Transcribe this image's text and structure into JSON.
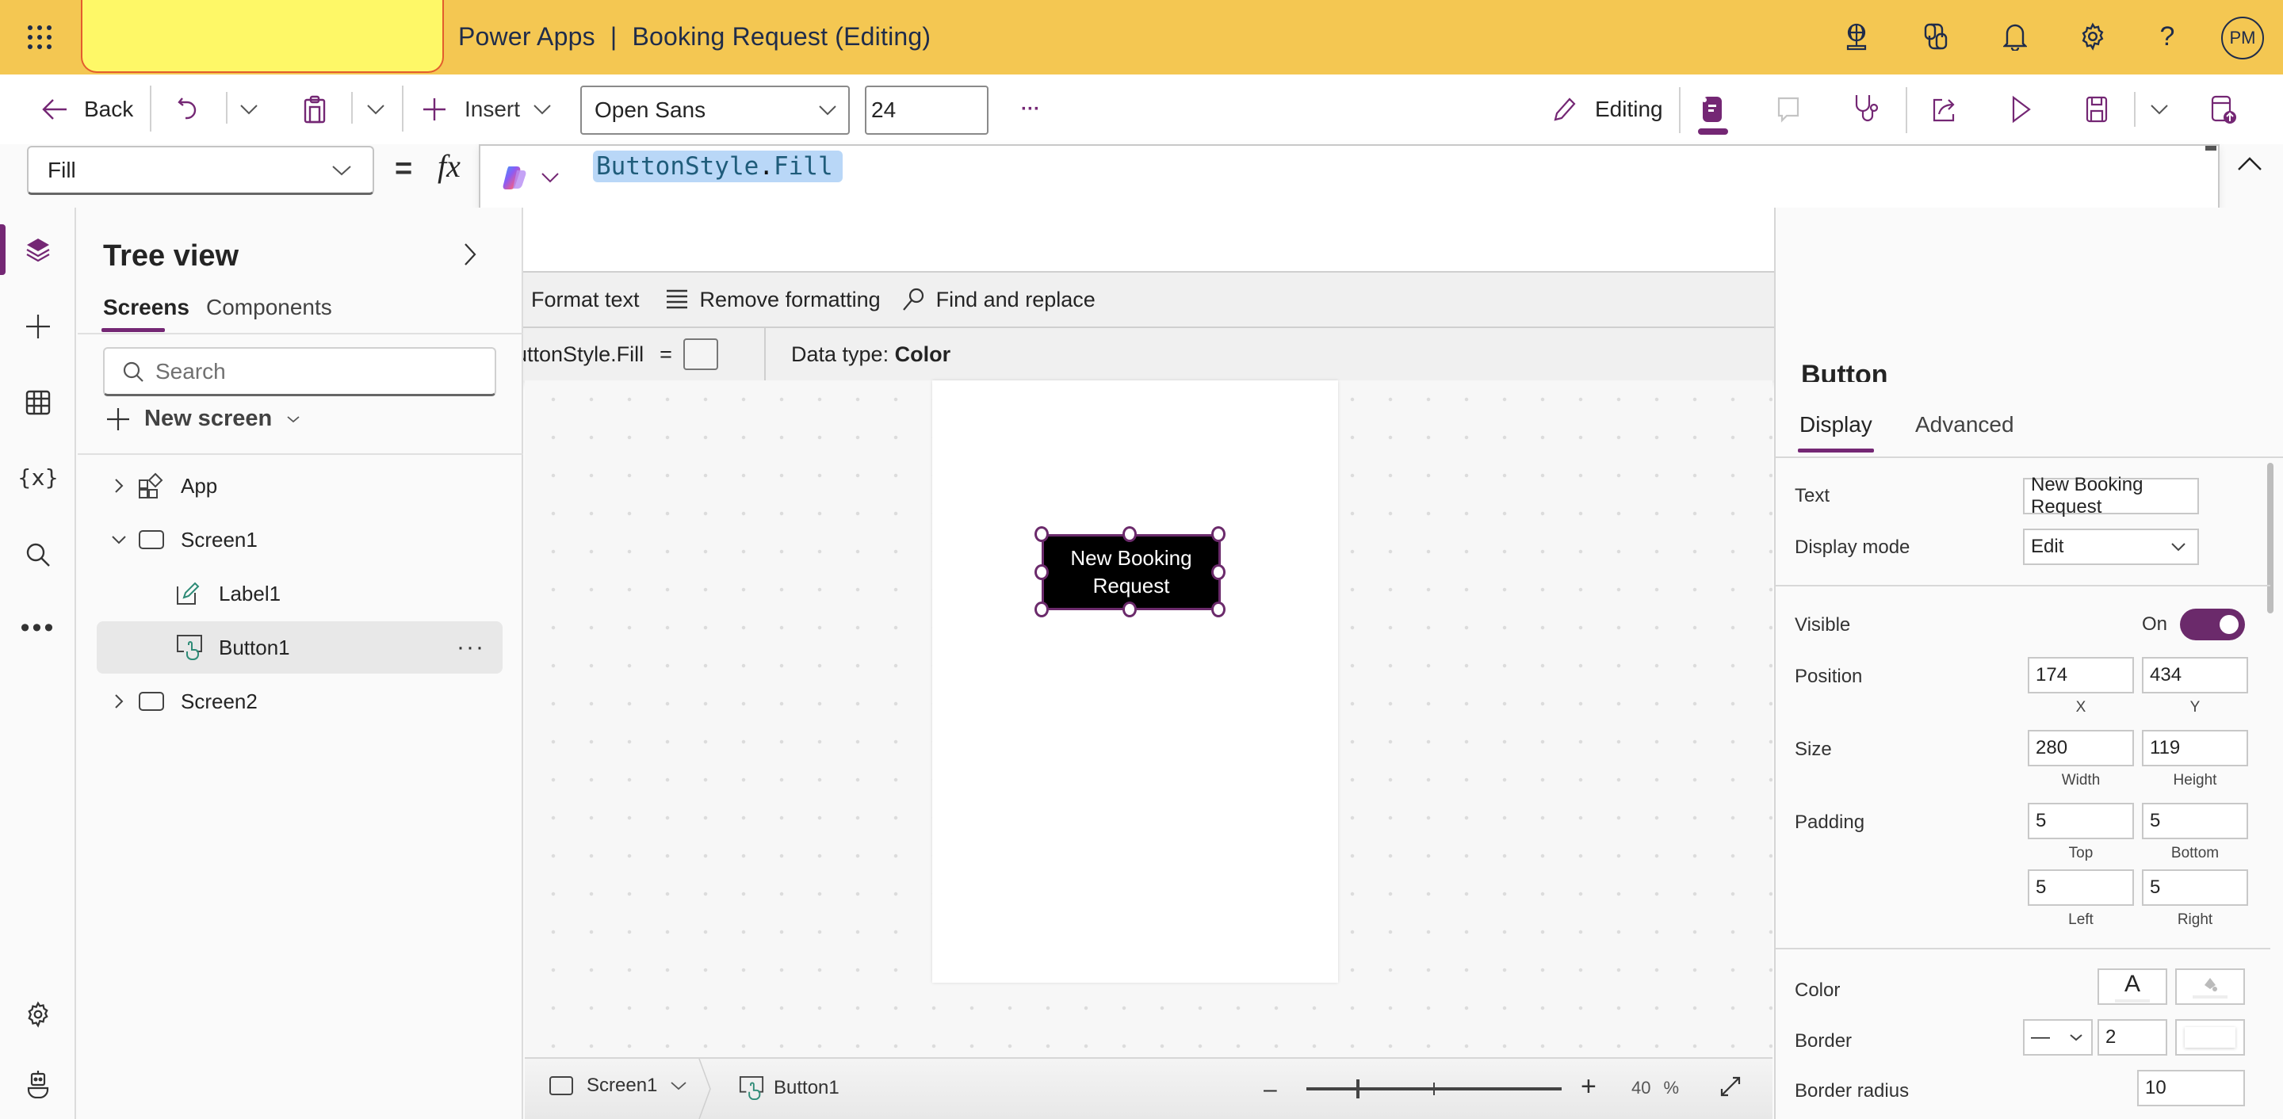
{
  "header": {
    "app_name": "Power Apps",
    "separator": "|",
    "document_title": "Booking Request (Editing)",
    "icons": [
      "environment-globe-icon",
      "copilot-icon",
      "bell-icon",
      "settings-gear-icon",
      "help-icon"
    ],
    "avatar_initials": "PM",
    "background_color": "#f4c752"
  },
  "command_bar": {
    "back_label": "Back",
    "insert_label": "Insert",
    "font_family_value": "Open Sans",
    "font_size_value": "24",
    "more_label": "···",
    "editing_label": "Editing"
  },
  "formula_bar": {
    "property": "Fill",
    "equals": "=",
    "fx": "fx",
    "formula_part1": "ButtonStyle",
    "formula_dot": ".",
    "formula_part2": "Fill",
    "format_text_label": "Format text",
    "remove_formatting_label": "Remove formatting",
    "find_replace_label": "Find and replace",
    "result_expression": "ButtonStyle.Fill",
    "result_equals": "=",
    "data_type_label": "Data type: ",
    "data_type_value": "Color"
  },
  "tree_view": {
    "title": "Tree view",
    "tabs": [
      {
        "label": "Screens",
        "active": true
      },
      {
        "label": "Components",
        "active": false
      }
    ],
    "search_placeholder": "Search",
    "new_screen_label": "New screen",
    "items": [
      {
        "label": "App",
        "level": 0,
        "expander": "collapsed",
        "icon": "app-icon"
      },
      {
        "label": "Screen1",
        "level": 0,
        "expander": "expanded",
        "icon": "screen-icon"
      },
      {
        "label": "Label1",
        "level": 1,
        "expander": "none",
        "icon": "label-edit-icon"
      },
      {
        "label": "Button1",
        "level": 1,
        "expander": "none",
        "icon": "button-icon",
        "selected": true,
        "more": "···"
      },
      {
        "label": "Screen2",
        "level": 0,
        "expander": "collapsed",
        "icon": "screen-icon"
      }
    ]
  },
  "canvas": {
    "button_text": "New Booking Request",
    "button_fill": "#000000",
    "selection_color": "#6b2a6b"
  },
  "status_bar": {
    "screen_label": "Screen1",
    "control_label": "Button1",
    "zoom_percent": 40,
    "zoom_value": "40",
    "zoom_unit": "%"
  },
  "properties": {
    "title_partial": "Button",
    "tabs": [
      {
        "label": "Display",
        "active": true
      },
      {
        "label": "Advanced",
        "active": false
      }
    ],
    "text_label": "Text",
    "text_value": "New Booking Request",
    "display_mode_label": "Display mode",
    "display_mode_value": "Edit",
    "visible_label": "Visible",
    "visible_state": "On",
    "visible_on": true,
    "position_label": "Position",
    "position_x": "174",
    "position_y": "434",
    "x_label": "X",
    "y_label": "Y",
    "size_label": "Size",
    "width_value": "280",
    "height_value": "119",
    "width_label": "Width",
    "height_label": "Height",
    "padding_label": "Padding",
    "padding_top": "5",
    "padding_bottom": "5",
    "padding_left": "5",
    "padding_right": "5",
    "top_label": "Top",
    "bottom_label": "Bottom",
    "left_label": "Left",
    "right_label": "Right",
    "color_label": "Color",
    "color_text_glyph": "A",
    "border_label": "Border",
    "border_style": "—",
    "border_width": "2",
    "border_radius_label": "Border radius",
    "border_radius_value": "10"
  },
  "accent_color": "#742774"
}
